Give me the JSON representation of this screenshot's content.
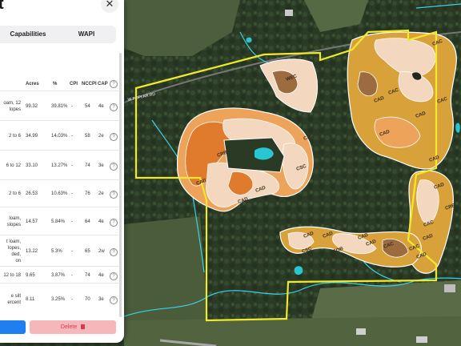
{
  "panel": {
    "title": "t",
    "close_icon": "close-icon",
    "tabs": [
      {
        "label": "Capabilities"
      },
      {
        "label": "WAPI"
      }
    ],
    "table": {
      "headers": {
        "acres": "Acres",
        "pct": "%",
        "cpi": "CPI",
        "nccpi": "NCCPI",
        "cap": "CAP"
      },
      "rows": [
        {
          "name": "oam, 12\nlopes",
          "acres": "99.32",
          "pct": "39.81%",
          "cpi": "-",
          "nccpi": "54",
          "cap": "4e"
        },
        {
          "name": "2 to 6",
          "acres": "34.99",
          "pct": "14.03%",
          "cpi": "-",
          "nccpi": "58",
          "cap": "2e"
        },
        {
          "name": "6 to 12",
          "acres": "33.10",
          "pct": "13.27%",
          "cpi": "-",
          "nccpi": "74",
          "cap": "3e"
        },
        {
          "name": "2 to 6",
          "acres": "26.53",
          "pct": "10.63%",
          "cpi": "-",
          "nccpi": "76",
          "cap": "2e"
        },
        {
          "name": "loam,\nslopes",
          "acres": "14.57",
          "pct": "5.84%",
          "cpi": "-",
          "nccpi": "64",
          "cap": "4e"
        },
        {
          "name": "t loam,\nlopes,\nded,\non",
          "acres": "13.22",
          "pct": "5.3%",
          "cpi": "-",
          "nccpi": "65",
          "cap": "2w"
        },
        {
          "name": "12 to 18",
          "acres": "9.65",
          "pct": "3.87%",
          "cpi": "-",
          "nccpi": "74",
          "cap": "4e"
        },
        {
          "name": "e silt\nercent",
          "acres": "8.11",
          "pct": "3.25%",
          "cpi": "-",
          "nccpi": "70",
          "cap": "3e"
        }
      ]
    },
    "delete_label": "Delete",
    "trash_icon": "trash-icon"
  },
  "map": {
    "soil_labels": [
      "WEC",
      "CAC",
      "CRB",
      "CSC",
      "CAD",
      "CAD",
      "CAD",
      "CAC",
      "CAC",
      "CAD",
      "CAD",
      "CAD",
      "CAC",
      "CAD",
      "CAD",
      "CRB",
      "CAC",
      "CAD",
      "CAD",
      "CSC",
      "CAD",
      "CAD",
      "EOB",
      "CAC",
      "CAD",
      "CAC",
      "CAD",
      "CAD"
    ],
    "road_label": "W POPLAR RD",
    "colors": {
      "boundary": "#f2e92a",
      "stream": "#3ad1e8",
      "soil_dark": "#e07a2c",
      "soil_orange": "#eea35a",
      "soil_light": "#f3d8bf",
      "soil_brown": "#9c6b40",
      "soil_gold": "#d9a13a",
      "pond": "#29c5d0"
    }
  }
}
